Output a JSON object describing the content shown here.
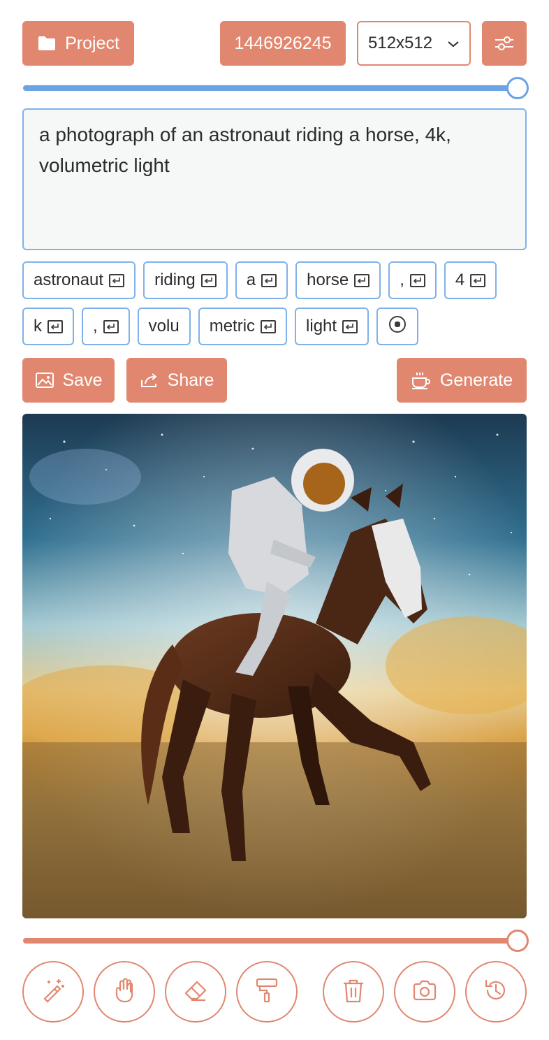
{
  "colors": {
    "accent": "#e2876f",
    "info": "#7fb2ea",
    "slider_top": "#6aa4e4"
  },
  "header": {
    "project_label": "Project",
    "seed": "1446926245",
    "size_selected": "512x512"
  },
  "sliders": {
    "top_value": 1.0,
    "bottom_value": 1.0
  },
  "prompt": {
    "text": "a photograph of an astronaut riding a horse, 4k, volumetric light"
  },
  "tokens": {
    "row1": [
      "astronaut",
      "riding",
      "a",
      "horse",
      ",",
      "4"
    ],
    "row2": [
      "k",
      ",",
      "volu",
      "metric",
      "light"
    ]
  },
  "actions": {
    "save_label": "Save",
    "share_label": "Share",
    "generate_label": "Generate"
  },
  "toolbar": {
    "tools": [
      "magic-wand-icon",
      "hand-icon",
      "eraser-icon",
      "paint-roller-icon",
      "trash-icon",
      "camera-icon",
      "history-icon"
    ]
  }
}
